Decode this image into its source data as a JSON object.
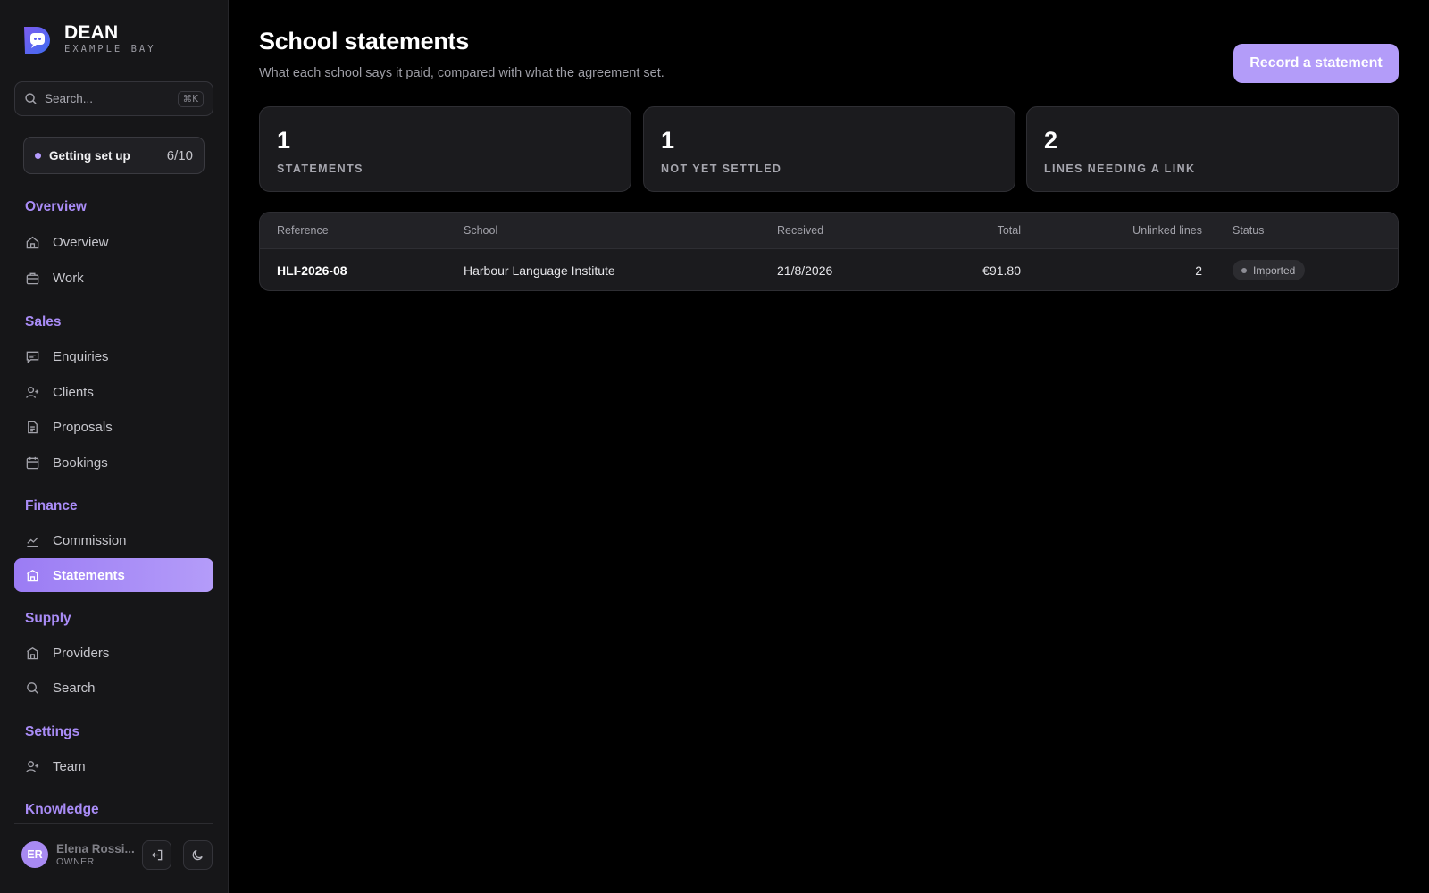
{
  "brand": {
    "name": "DEAN",
    "subtitle": "EXAMPLE BAY"
  },
  "search": {
    "placeholder": "Search...",
    "shortcut": "⌘K"
  },
  "setup": {
    "label": "Getting set up",
    "progress": "6/10"
  },
  "nav": {
    "sections": [
      {
        "title": "Overview",
        "items": [
          {
            "label": "Overview",
            "icon": "home-icon"
          },
          {
            "label": "Work",
            "icon": "briefcase-icon"
          }
        ]
      },
      {
        "title": "Sales",
        "items": [
          {
            "label": "Enquiries",
            "icon": "message-icon"
          },
          {
            "label": "Clients",
            "icon": "user-plus-icon"
          },
          {
            "label": "Proposals",
            "icon": "document-icon"
          },
          {
            "label": "Bookings",
            "icon": "calendar-icon"
          }
        ]
      },
      {
        "title": "Finance",
        "items": [
          {
            "label": "Commission",
            "icon": "trend-icon"
          },
          {
            "label": "Statements",
            "icon": "bank-icon",
            "active": true
          }
        ]
      },
      {
        "title": "Supply",
        "items": [
          {
            "label": "Providers",
            "icon": "bank-icon"
          },
          {
            "label": "Search",
            "icon": "search-icon"
          }
        ]
      },
      {
        "title": "Settings",
        "items": [
          {
            "label": "Team",
            "icon": "user-plus-icon"
          }
        ]
      },
      {
        "title": "Knowledge",
        "items": []
      }
    ]
  },
  "user": {
    "initials": "ER",
    "name": "Elena Rossi...",
    "role": "OWNER"
  },
  "page": {
    "title": "School statements",
    "subtitle": "What each school says it paid, compared with what the agreement set.",
    "primary_action": "Record a statement"
  },
  "stats": [
    {
      "value": "1",
      "label": "STATEMENTS"
    },
    {
      "value": "1",
      "label": "NOT YET SETTLED"
    },
    {
      "value": "2",
      "label": "LINES NEEDING A LINK"
    }
  ],
  "table": {
    "columns": [
      "Reference",
      "School",
      "Received",
      "Total",
      "Unlinked lines",
      "Status"
    ],
    "rows": [
      {
        "reference": "HLI-2026-08",
        "school": "Harbour Language Institute",
        "received": "21/8/2026",
        "total": "€91.80",
        "unlinked": "2",
        "status": "Imported"
      }
    ]
  },
  "colors": {
    "accent": "#a98cf6",
    "active_nav": "#b49cf9",
    "primary_button": "#b39cf9",
    "background": "#000000",
    "sidebar": "#161618"
  }
}
